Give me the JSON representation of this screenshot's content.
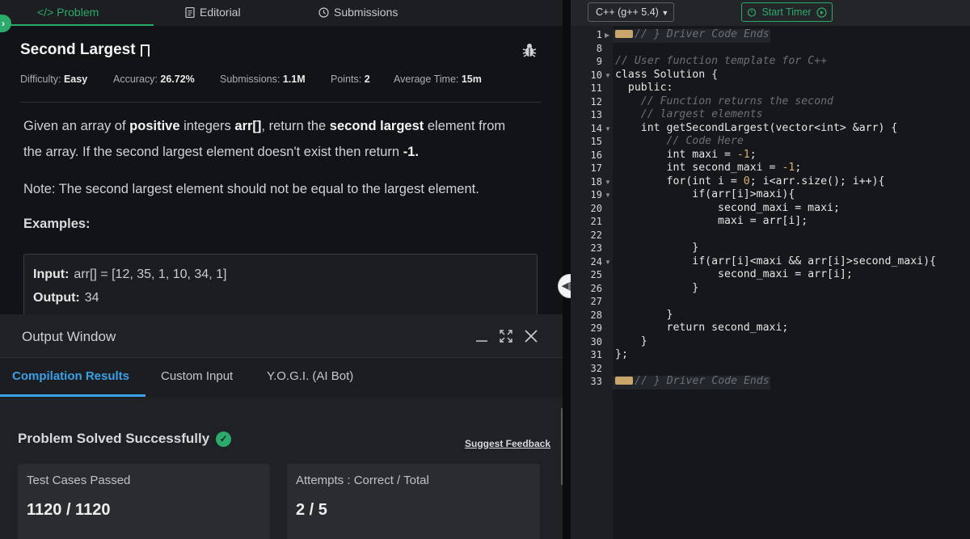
{
  "tabs": [
    {
      "label": "</> Problem",
      "active": true
    },
    {
      "label": "Editorial",
      "active": false
    },
    {
      "label": "Submissions",
      "active": false
    }
  ],
  "problem": {
    "title": "Second Largest",
    "difficulty_label": "Difficulty:",
    "difficulty": "Easy",
    "accuracy_label": "Accuracy:",
    "accuracy": "26.72%",
    "submissions_label": "Submissions:",
    "submissions": "1.1M",
    "points_label": "Points:",
    "points": "2",
    "avgtime_label": "Average Time:",
    "avgtime": "15m",
    "desc1_a": "Given an array of ",
    "desc1_b": "positive",
    "desc1_c": " integers ",
    "desc1_d": "arr[]",
    "desc1_e": ", return the ",
    "desc1_f": "second largest",
    "desc1_g": " element from",
    "desc2_a": "the array. If the second largest element doesn't exist then return ",
    "desc2_b": "-1.",
    "note": "Note: The second largest element should not be equal to the largest element.",
    "examples_title": "Examples:",
    "input_label": "Input:",
    "input_value": "arr[]  =  [12,  35,  1,  10,  34,  1]",
    "output_label": "Output:",
    "output_value": "34"
  },
  "output_window": {
    "title": "Output Window",
    "tabs": [
      "Compilation Results",
      "Custom Input",
      "Y.O.G.I. (AI Bot)"
    ],
    "status": "Problem Solved Successfully",
    "feedback": "Suggest Feedback",
    "cards": [
      {
        "label": "Test Cases Passed",
        "value": "1120 / 1120"
      },
      {
        "label": "Attempts : Correct / Total",
        "value": "2 / 5"
      }
    ]
  },
  "editor": {
    "language": "C++ (g++ 5.4)",
    "timer": "Start Timer",
    "line_numbers": [
      "1",
      "8",
      "9",
      "10",
      "11",
      "12",
      "13",
      "14",
      "15",
      "16",
      "17",
      "18",
      "19",
      "20",
      "21",
      "22",
      "23",
      "24",
      "25",
      "26",
      "27",
      "28",
      "29",
      "30",
      "31",
      "32",
      "33"
    ],
    "lines": [
      "// } Driver Code Ends",
      "",
      "// User function template for C++",
      "class Solution {",
      "  public:",
      "    // Function returns the second",
      "    // largest elements",
      "    int getSecondLargest(vector<int> &arr) {",
      "        // Code Here",
      "        int maxi = -1;",
      "        int second_maxi = -1;",
      "        for(int i = 0; i<arr.size(); i++){",
      "            if(arr[i]>maxi){",
      "                second_maxi = maxi;",
      "                maxi = arr[i];",
      "",
      "            }",
      "            if(arr[i]<maxi && arr[i]>second_maxi){",
      "                second_maxi = arr[i];",
      "            }",
      "",
      "        }",
      "        return second_maxi;",
      "    }",
      "};",
      "",
      "// } Driver Code Ends"
    ]
  },
  "colors": {
    "accent_green": "#2bab6b",
    "accent_blue": "#3aa0e8"
  }
}
